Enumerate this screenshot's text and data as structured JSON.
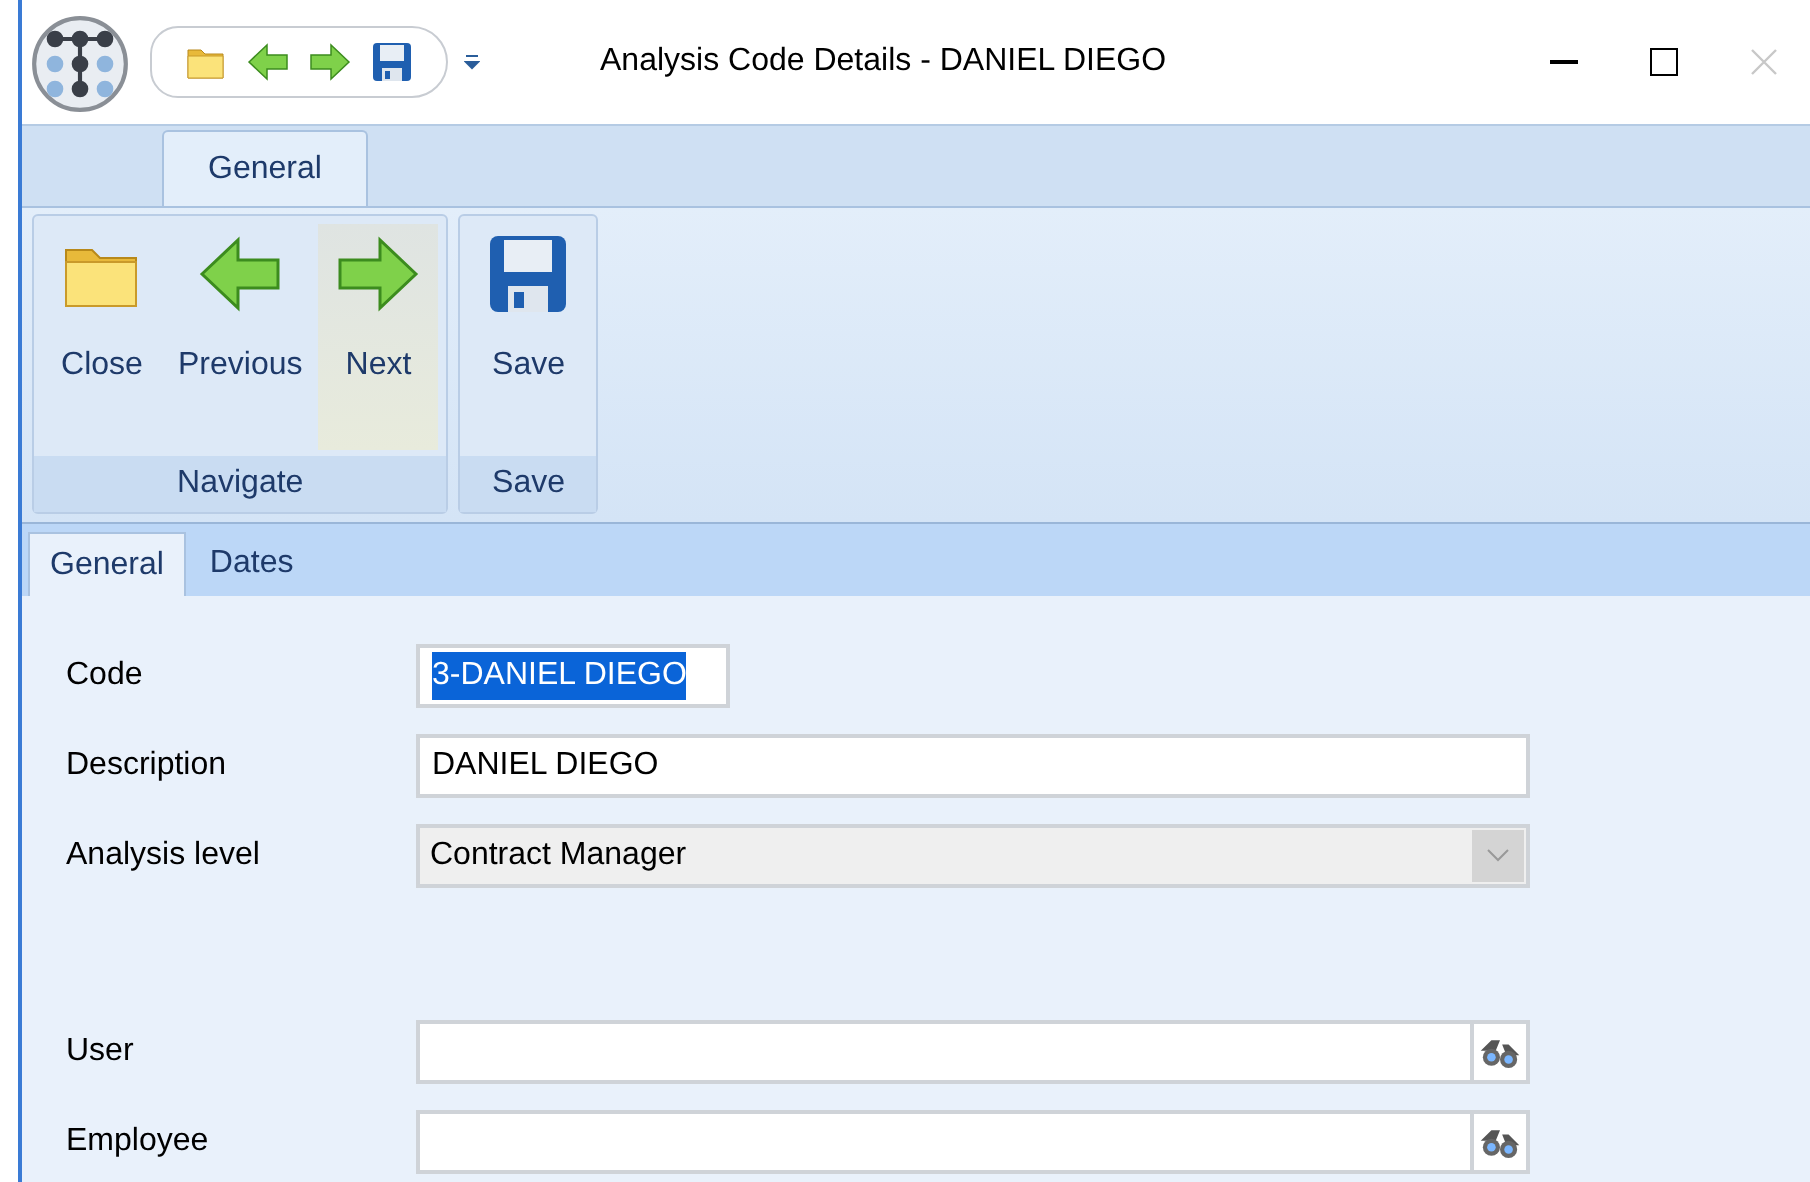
{
  "window": {
    "title": "Analysis Code Details - DANIEL DIEGO"
  },
  "ribbon": {
    "tabs": [
      {
        "label": "General",
        "selected": true
      }
    ],
    "groups": [
      {
        "label": "Navigate",
        "buttons": [
          {
            "label": "Close",
            "kind": "folder",
            "highlighted": false
          },
          {
            "label": "Previous",
            "kind": "back",
            "highlighted": false
          },
          {
            "label": "Next",
            "kind": "forward",
            "highlighted": true
          }
        ]
      },
      {
        "label": "Save",
        "buttons": [
          {
            "label": "Save",
            "kind": "save",
            "highlighted": false
          }
        ]
      }
    ]
  },
  "tabs": [
    {
      "label": "General",
      "selected": true
    },
    {
      "label": "Dates",
      "selected": false
    }
  ],
  "fields": [
    {
      "label": "Code",
      "kind": "text",
      "value": "3-DANIEL DIEGO",
      "text_selected": true
    },
    {
      "label": "Description",
      "kind": "text",
      "value": "DANIEL DIEGO",
      "text_selected": false
    },
    {
      "label": "Analysis level",
      "kind": "dropdown",
      "value": "Contract Manager",
      "disabled": true
    },
    {
      "kind": "spacer"
    },
    {
      "label": "User",
      "kind": "lookup"
    },
    {
      "label": "Employee",
      "kind": "lookup"
    }
  ]
}
